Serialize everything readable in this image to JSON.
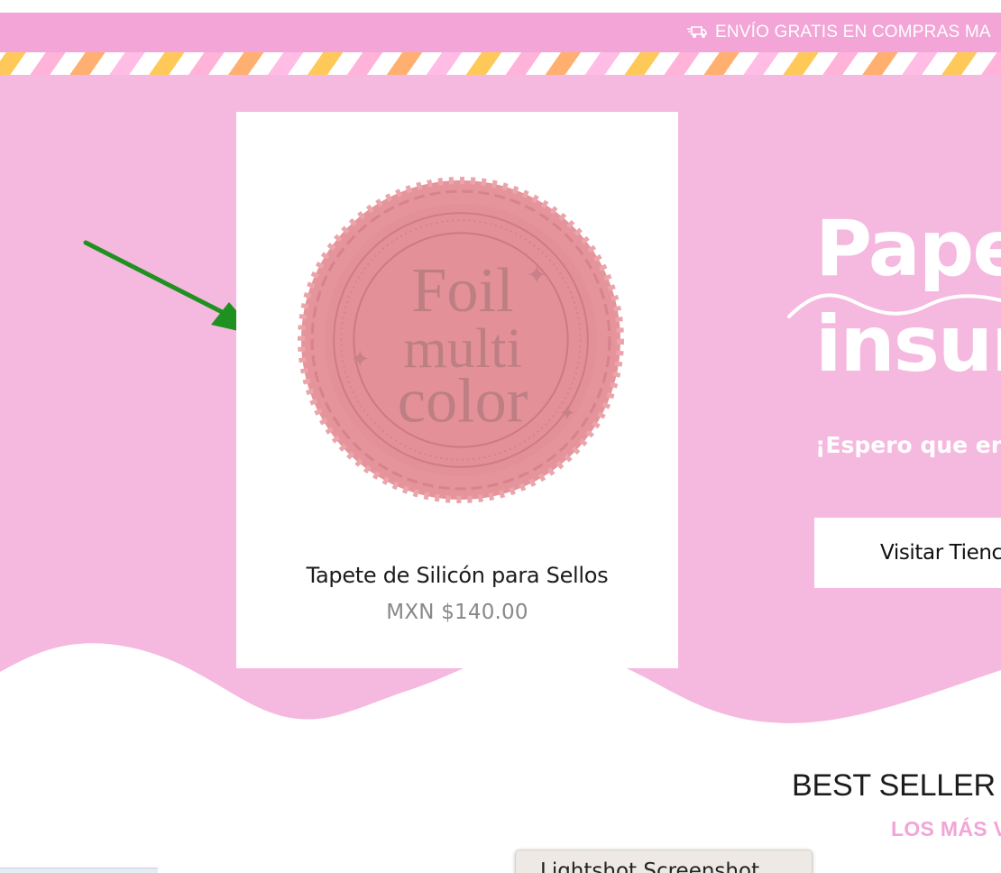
{
  "announcement": {
    "icon": "truck-icon",
    "text": "ENVÍO GRATIS EN COMPRAS MA"
  },
  "hero": {
    "title_line1": "Pape",
    "title_line2": "insur",
    "subtitle": "¡Espero que enc",
    "button_label": "Visitar Tienc"
  },
  "product": {
    "image_text": "Foil multi color",
    "title": "Tapete de Silicón para Sellos",
    "price": "MXN $140.00"
  },
  "best_seller": {
    "title": "BEST SELLER C",
    "subtitle": "LOS MÁS V"
  },
  "tooltip": {
    "text": "Lightshot Screenshot"
  },
  "colors": {
    "brand_pink": "#f2a5d6",
    "hero_pink": "#f5b8df",
    "annotation_green": "#1e9120",
    "seal_pink": "#e08a93"
  }
}
